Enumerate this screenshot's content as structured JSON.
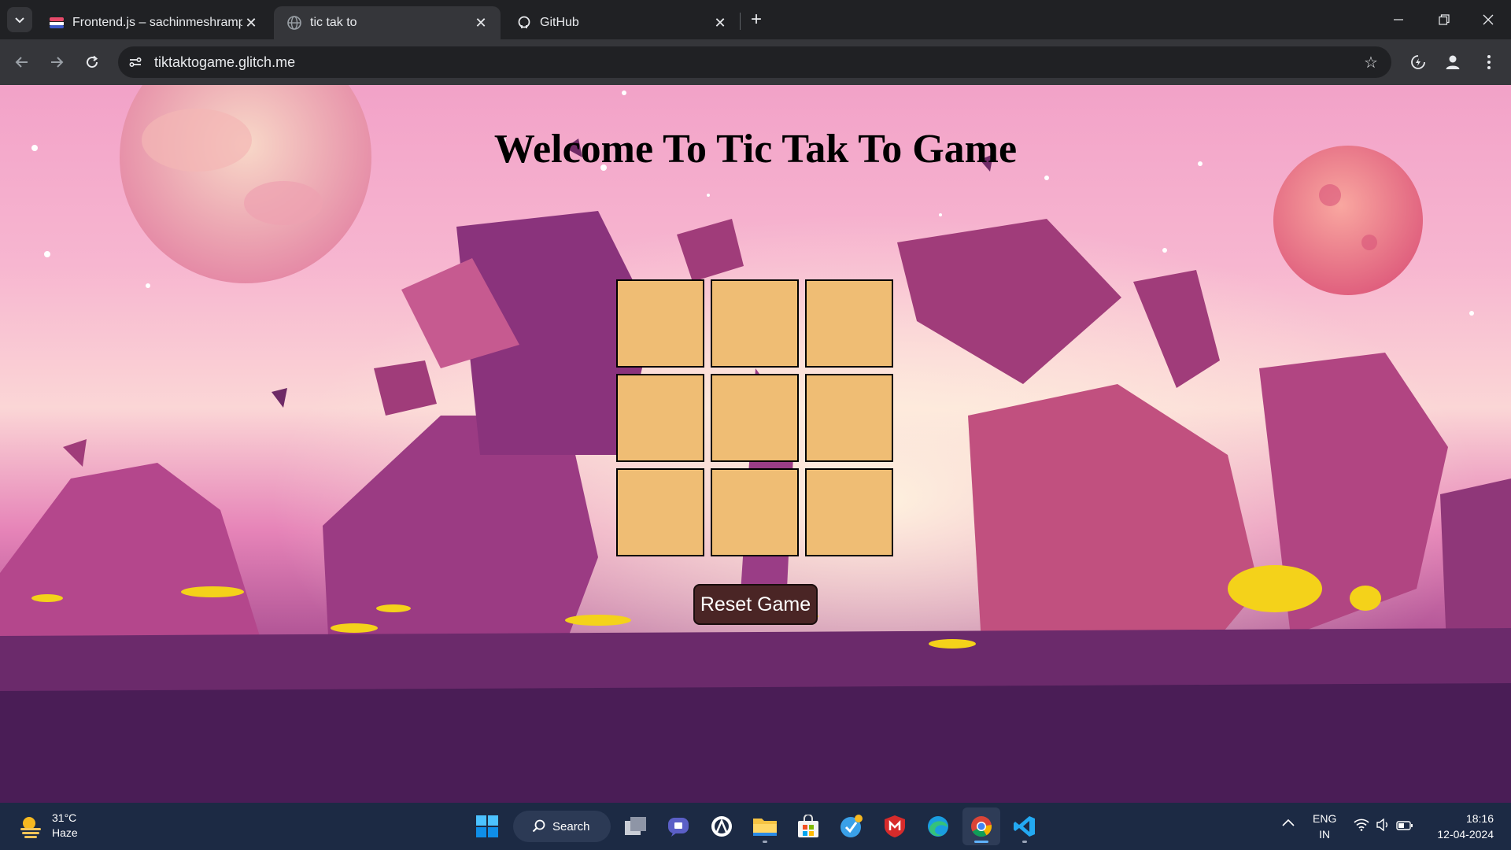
{
  "browser": {
    "tabs": [
      {
        "title": "Frontend.js – sachinmeshrampo",
        "active": false
      },
      {
        "title": "tic tak to",
        "active": true
      },
      {
        "title": "GitHub",
        "active": false
      }
    ],
    "url": "tiktaktogame.glitch.me"
  },
  "page": {
    "heading": "Welcome To Tic Tak To Game",
    "board": {
      "cells": [
        "",
        "",
        "",
        "",
        "",
        "",
        "",
        "",
        ""
      ]
    },
    "reset_label": "Reset Game",
    "colors": {
      "cell": "#efbd74",
      "button": "#4a2525"
    }
  },
  "taskbar": {
    "weather": {
      "temp": "31°C",
      "condition": "Haze"
    },
    "search_label": "Search",
    "apps": [
      "start-icon",
      "task-view-icon",
      "teams-icon",
      "app-icon",
      "file-explorer-icon",
      "store-icon",
      "tasks-icon",
      "mcafee-icon",
      "edge-icon",
      "chrome-icon",
      "vscode-icon"
    ],
    "tray": {
      "lang_top": "ENG",
      "lang_bottom": "IN",
      "time": "18:16",
      "date": "12-04-2024"
    }
  }
}
